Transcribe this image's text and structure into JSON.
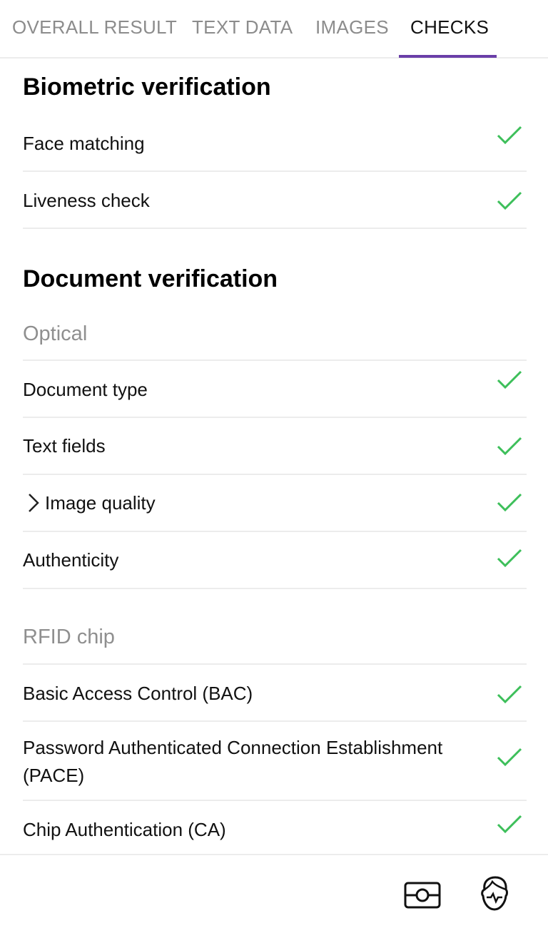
{
  "tabs": [
    {
      "label": "OVERALL RESULT",
      "active": false
    },
    {
      "label": "TEXT DATA",
      "active": false
    },
    {
      "label": "IMAGES",
      "active": false
    },
    {
      "label": "CHECKS",
      "active": true
    }
  ],
  "biometric": {
    "title": "Biometric verification",
    "items": [
      {
        "label": "Face matching",
        "status": "passed"
      },
      {
        "label": "Liveness check",
        "status": "passed"
      }
    ]
  },
  "document": {
    "title": "Document verification",
    "optical": {
      "title": "Optical",
      "items": [
        {
          "label": "Document type",
          "status": "passed"
        },
        {
          "label": "Text fields",
          "status": "passed"
        },
        {
          "label": "Image quality",
          "status": "passed",
          "expandable": true
        },
        {
          "label": "Authenticity",
          "status": "passed"
        }
      ]
    },
    "rfid": {
      "title": "RFID chip",
      "items": [
        {
          "label": "Basic Access Control (BAC)",
          "status": "passed"
        },
        {
          "label": "Password Authenticated Connection Establishment (PACE)",
          "status": "passed"
        },
        {
          "label": "Chip Authentication (CA)",
          "status": "passed"
        }
      ]
    }
  },
  "bottom_bar": {
    "icons": [
      "document-scan-icon",
      "face-liveness-icon"
    ]
  },
  "colors": {
    "accent": "#6a3fa8",
    "check": "#3dbf5a",
    "muted": "#8f8f8f"
  }
}
